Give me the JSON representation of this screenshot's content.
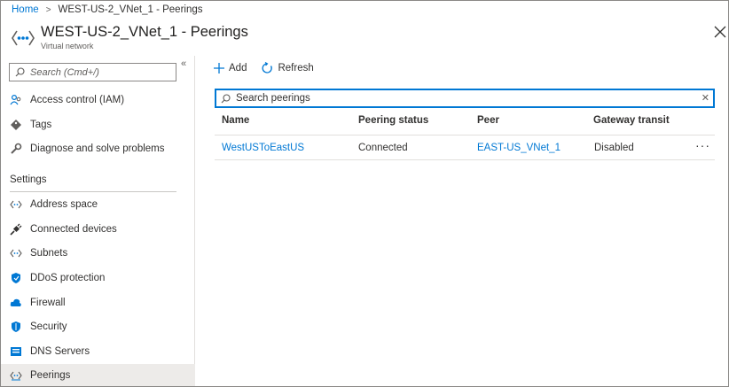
{
  "breadcrumb": {
    "home": "Home",
    "separator": ">",
    "current": "WEST-US-2_VNet_1 - Peerings"
  },
  "header": {
    "title": "WEST-US-2_VNet_1 - Peerings",
    "subtitle": "Virtual network",
    "icon": "vnet-icon"
  },
  "sidebar": {
    "search_placeholder": "Search (Cmd+/)",
    "collapse_label": "«",
    "items": [
      {
        "label": "Access control (IAM)",
        "icon": "people-icon"
      },
      {
        "label": "Tags",
        "icon": "tag-icon"
      },
      {
        "label": "Diagnose and solve problems",
        "icon": "wrench-icon"
      }
    ],
    "settings_header": "Settings",
    "settings_items": [
      {
        "label": "Address space",
        "icon": "arrows-icon"
      },
      {
        "label": "Connected devices",
        "icon": "plug-icon"
      },
      {
        "label": "Subnets",
        "icon": "arrows-icon"
      },
      {
        "label": "DDoS protection",
        "icon": "shield-icon"
      },
      {
        "label": "Firewall",
        "icon": "cloud-icon"
      },
      {
        "label": "Security",
        "icon": "shield-icon"
      },
      {
        "label": "DNS Servers",
        "icon": "dns-icon"
      },
      {
        "label": "Peerings",
        "icon": "peerings-icon",
        "selected": true
      }
    ]
  },
  "toolbar": {
    "add_label": "Add",
    "refresh_label": "Refresh"
  },
  "search": {
    "placeholder": "Search peerings"
  },
  "table": {
    "headers": [
      "Name",
      "Peering status",
      "Peer",
      "Gateway transit"
    ],
    "rows": [
      {
        "name": "WestUSToEastUS",
        "status": "Connected",
        "peer": "EAST-US_VNet_1",
        "gateway_transit": "Disabled",
        "more": "···"
      }
    ]
  },
  "colors": {
    "accent": "#0078d4",
    "selected_bg": "#edebe9",
    "text": "#323130"
  }
}
